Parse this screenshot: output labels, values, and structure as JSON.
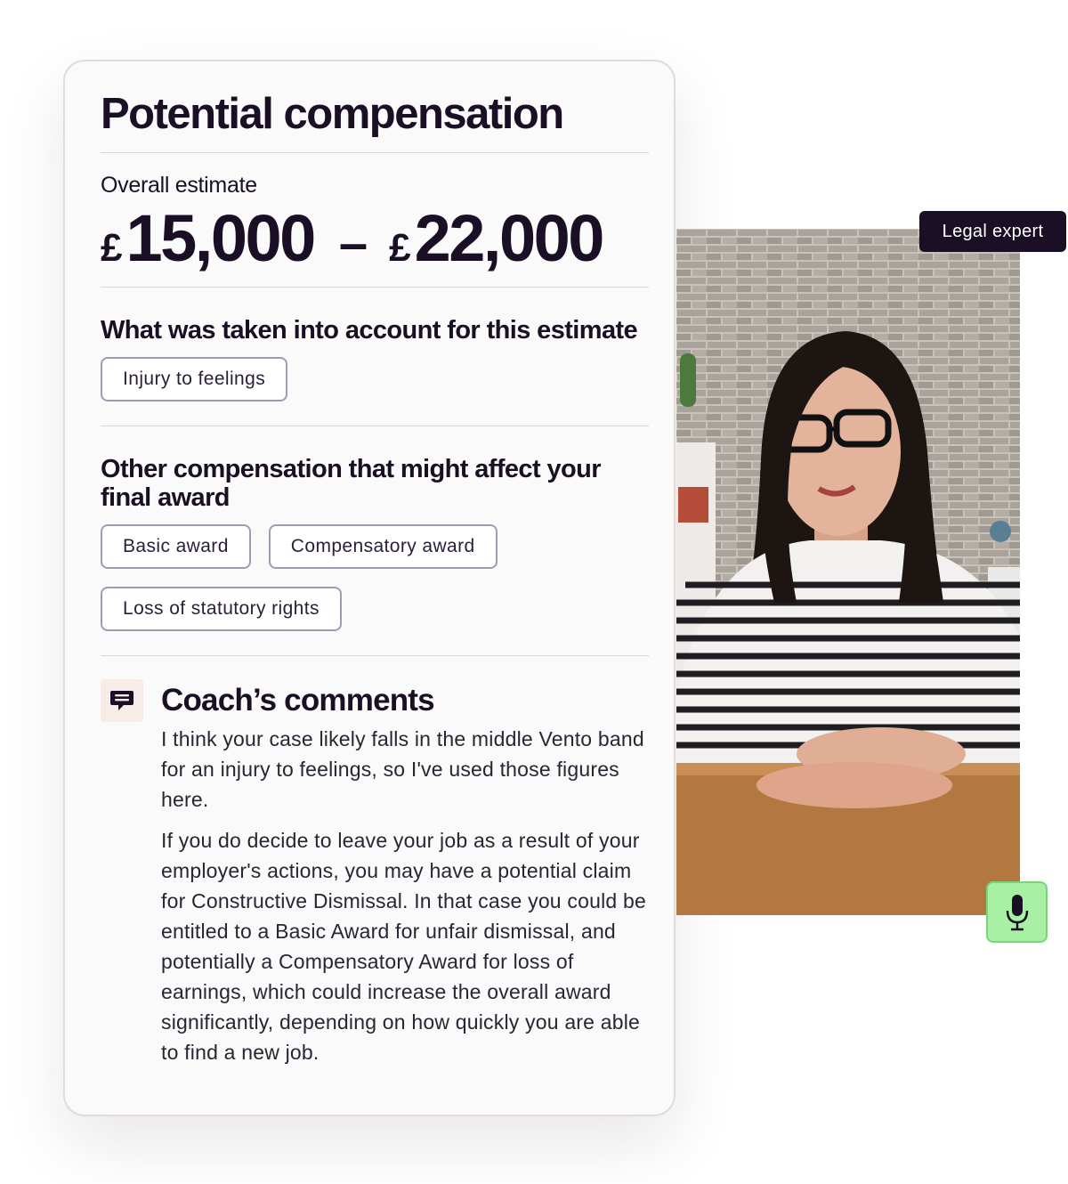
{
  "card": {
    "title": "Potential compensation",
    "estimate_label": "Overall estimate",
    "estimate": {
      "currency": "£",
      "low": "15,000",
      "separator": "–",
      "high": "22,000"
    },
    "taken_into_account": {
      "title": "What was taken into account for this estimate",
      "chips": [
        "Injury to feelings"
      ]
    },
    "other_compensation": {
      "title_line1": "Other compensation that might affect your",
      "title_line2": "final award",
      "chips": [
        "Basic award",
        "Compensatory award",
        "Loss of statutory rights"
      ]
    },
    "coach": {
      "title": "Coach’s comments",
      "icon": "speech-bubble-icon",
      "paragraphs": [
        "I think your case likely falls in the middle Vento band for an injury to feelings, so I've used those figures here.",
        "If you do decide to leave your job as a result of your  employer's actions, you may have a potential claim for Constructive  Dismissal. In that case you could be entitled to a Basic Award for  unfair dismissal, and potentially a Compensatory Award for loss of  earnings, which could increase the overall award significantly, depending on how quickly you are able to find a new job."
      ]
    }
  },
  "video": {
    "badge": "Legal expert",
    "mic_icon": "microphone-icon"
  },
  "colors": {
    "text_dark": "#1a0f24",
    "card_bg": "#fafafa",
    "chip_border": "#a49ab0",
    "badge_bg": "#1a0f24",
    "mic_bg": "#a8f0a4",
    "coach_icon_bg": "#f7ece6"
  }
}
